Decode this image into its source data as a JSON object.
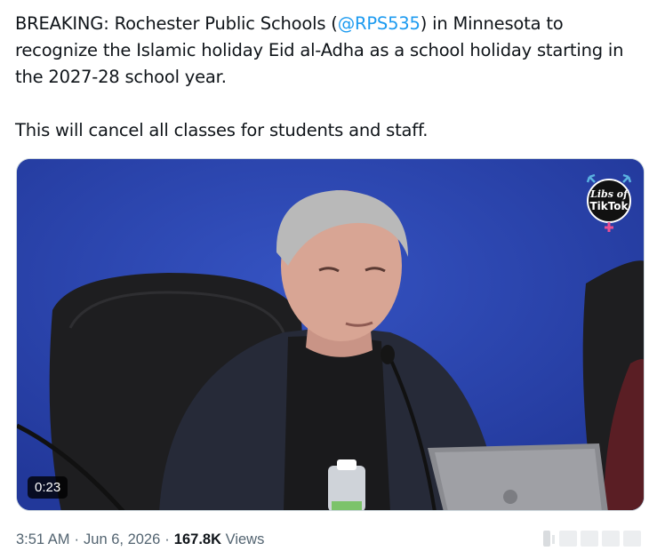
{
  "tweet": {
    "line_prefix": "BREAKING: Rochester Public Schools (",
    "mention": "@RPS535",
    "line_suffix": ") in Minnesota to recognize the Islamic holiday Eid al-Adha as a school holiday starting in the 2027-28 school year.",
    "paragraph2": "This will cancel all classes for students and staff."
  },
  "video": {
    "duration": "0:23",
    "watermark_line1": "Libs of",
    "watermark_line2": "TikTok"
  },
  "meta": {
    "time": "3:51 AM",
    "date": "Jun 6, 2026",
    "views_count": "167.8K",
    "views_label": "Views",
    "separator": "·"
  },
  "colors": {
    "mention": "#1d9bf0",
    "text": "#0f1419",
    "muted": "#536471",
    "video_bg": "#2a43a8"
  }
}
